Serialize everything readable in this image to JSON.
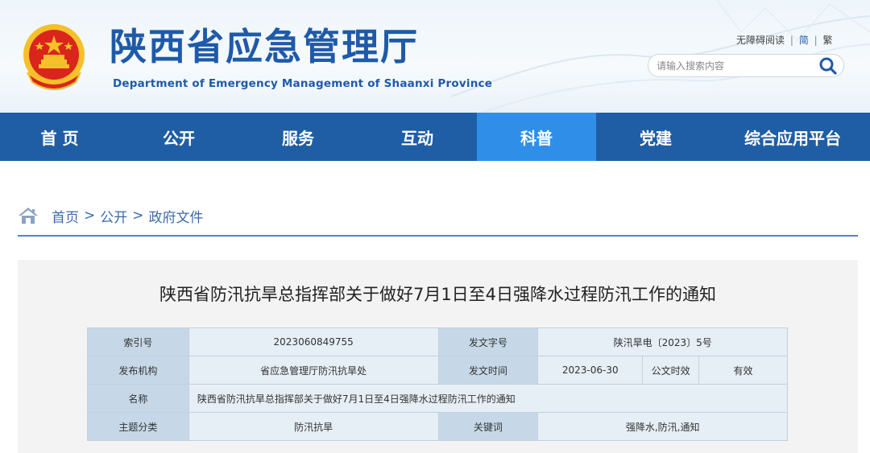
{
  "site": {
    "title": "陕西省应急管理厅",
    "subtitle": "Department of Emergency Management of Shaanxi Province"
  },
  "tools": {
    "accessibility": "无障碍阅读",
    "lang_simplified": "简",
    "lang_traditional": "繁",
    "separator": "|"
  },
  "search": {
    "placeholder": "请输入搜索内容",
    "value": ""
  },
  "nav": {
    "items": [
      {
        "label": "首 页"
      },
      {
        "label": "公开"
      },
      {
        "label": "服务"
      },
      {
        "label": "互动"
      },
      {
        "label": "科普"
      },
      {
        "label": "党建"
      },
      {
        "label": "综合应用平台"
      }
    ],
    "active_index": 4
  },
  "breadcrumb": {
    "items": [
      "首页",
      "公开",
      "政府文件"
    ],
    "separator": ">"
  },
  "article": {
    "title": "陕西省防汛抗旱总指挥部关于做好7月1日至4日强降水过程防汛工作的通知",
    "meta": {
      "index_label": "索引号",
      "index_value": "2023060849755",
      "doc_no_label": "发文字号",
      "doc_no_value": "陕汛旱电〔2023〕5号",
      "issuer_label": "发布机构",
      "issuer_value": "省应急管理厅防汛抗旱处",
      "date_label": "发文时间",
      "date_value": "2023-06-30",
      "effect_label": "公文时效",
      "effect_value": "有效",
      "name_label": "名称",
      "name_value": "陕西省防汛抗旱总指挥部关于做好7月1日至4日强降水过程防汛工作的通知",
      "topic_label": "主题分类",
      "topic_value": "防汛抗旱",
      "keywords_label": "关键词",
      "keywords_value": "强降水,防汛,通知"
    }
  },
  "colors": {
    "brand_blue": "#1f5aa8",
    "nav_bg": "#1f5ea5",
    "nav_active": "#2f8fe8",
    "emblem_red": "#d9251c",
    "emblem_gold": "#f5c02a"
  },
  "icons": {
    "emblem": "national-emblem-icon",
    "search": "search-icon",
    "home": "home-icon"
  }
}
